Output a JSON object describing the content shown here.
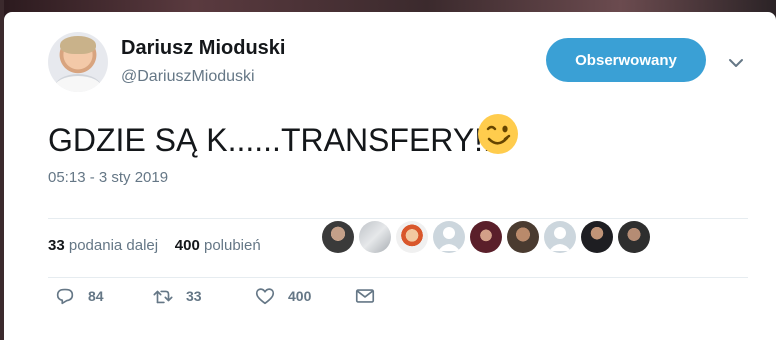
{
  "author": {
    "name": "Dariusz Mioduski",
    "handle": "@DariuszMioduski"
  },
  "follow_button": {
    "label": "Obserwowany",
    "color": "#3aa0d5"
  },
  "tweet": {
    "text": "GDZIE SĄ K......TRANSFERY!!!",
    "emoji": "winking-face-emoji",
    "timestamp": "05:13 - 3 sty 2019"
  },
  "stats": {
    "retweets_count": "33",
    "retweets_label": "podania dalej",
    "likes_count": "400",
    "likes_label": "polubień"
  },
  "likers": [
    {
      "icon": "liker-avatar-1"
    },
    {
      "icon": "liker-avatar-2"
    },
    {
      "icon": "liker-avatar-3"
    },
    {
      "icon": "default-avatar-icon"
    },
    {
      "icon": "liker-avatar-5"
    },
    {
      "icon": "liker-avatar-6"
    },
    {
      "icon": "default-avatar-icon"
    },
    {
      "icon": "liker-avatar-8"
    },
    {
      "icon": "liker-avatar-9"
    }
  ],
  "actions": {
    "reply_count": "84",
    "retweet_count": "33",
    "like_count": "400"
  },
  "colors": {
    "text": "#14171a",
    "secondary": "#657786",
    "divider": "#e6ecf0"
  }
}
